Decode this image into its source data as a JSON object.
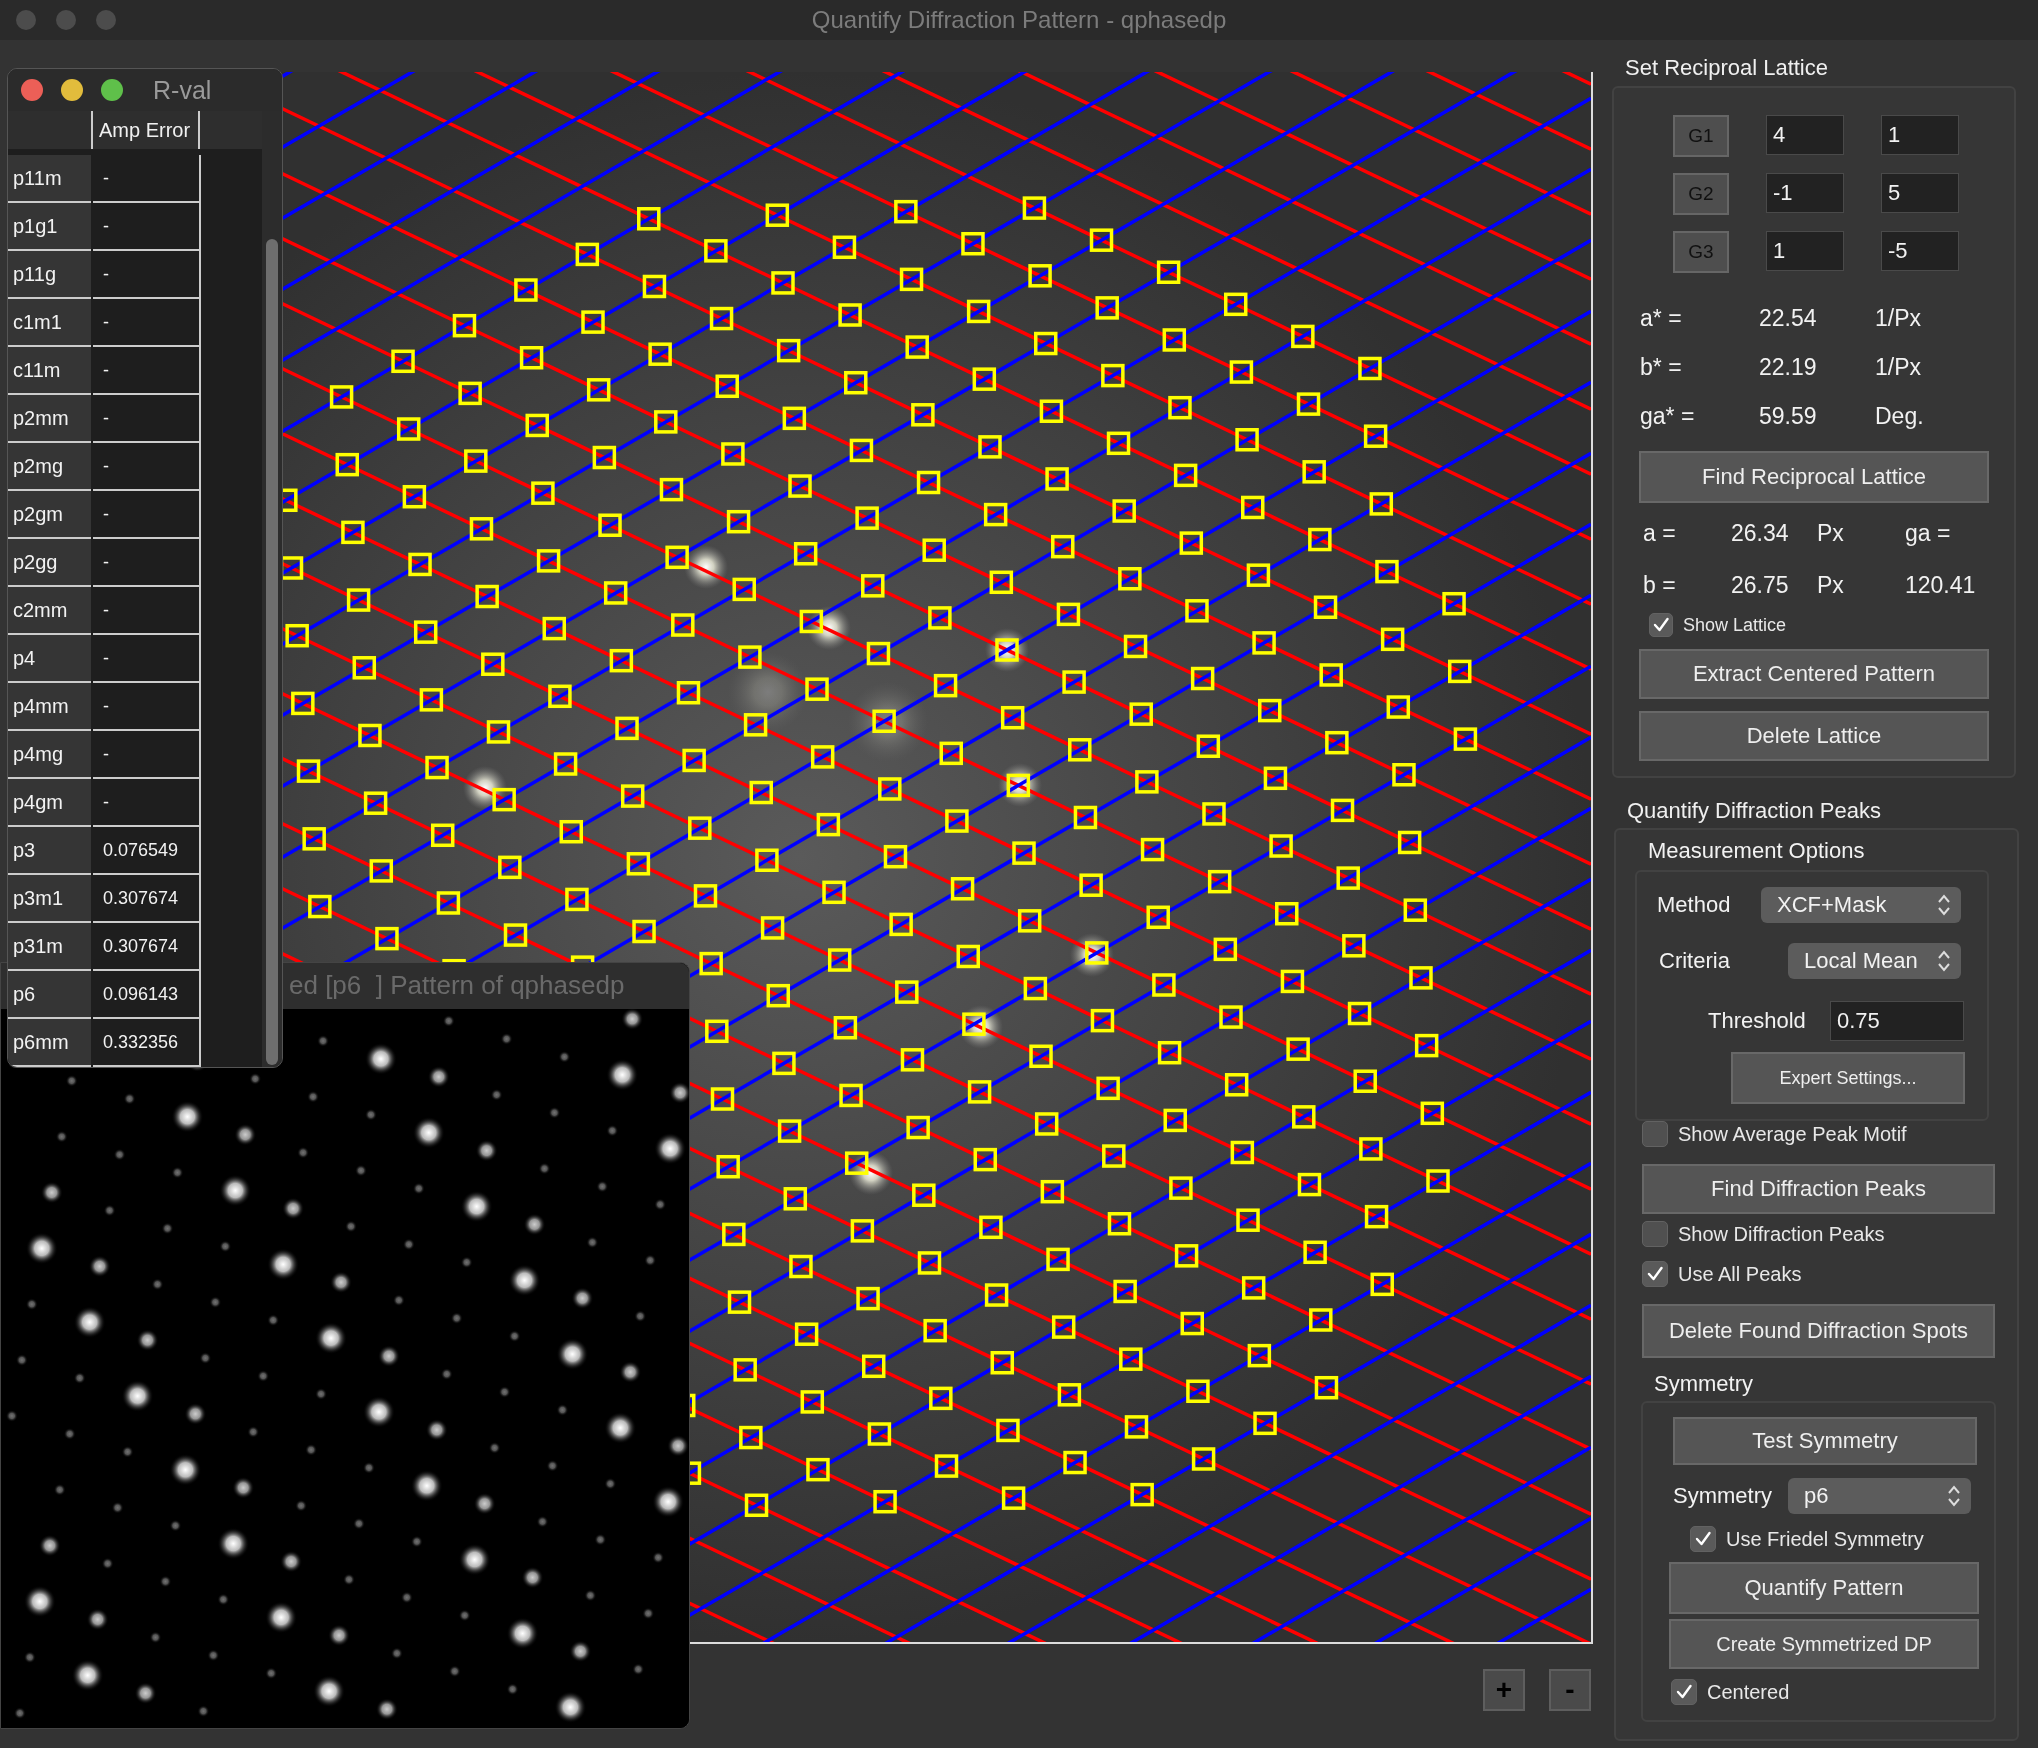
{
  "window": {
    "title": "Quantify Diffraction Pattern - qphasedp"
  },
  "image_view": {
    "zoom_buttons": [
      "+",
      "-"
    ]
  },
  "rval_window": {
    "title": "R-val",
    "columns": [
      "Amp Error"
    ],
    "rows": [
      {
        "group": "p11m",
        "amp_error": "-"
      },
      {
        "group": "p1g1",
        "amp_error": "-"
      },
      {
        "group": "p11g",
        "amp_error": "-"
      },
      {
        "group": "c1m1",
        "amp_error": "-"
      },
      {
        "group": "c11m",
        "amp_error": "-"
      },
      {
        "group": "p2mm",
        "amp_error": "-"
      },
      {
        "group": "p2mg",
        "amp_error": "-"
      },
      {
        "group": "p2gm",
        "amp_error": "-"
      },
      {
        "group": "p2gg",
        "amp_error": "-"
      },
      {
        "group": "c2mm",
        "amp_error": "-"
      },
      {
        "group": "p4",
        "amp_error": "-"
      },
      {
        "group": "p4mm",
        "amp_error": "-"
      },
      {
        "group": "p4mg",
        "amp_error": "-"
      },
      {
        "group": "p4gm",
        "amp_error": "-"
      },
      {
        "group": "p3",
        "amp_error": "0.076549"
      },
      {
        "group": "p3m1",
        "amp_error": "0.307674"
      },
      {
        "group": "p31m",
        "amp_error": "0.307674"
      },
      {
        "group": "p6",
        "amp_error": "0.096143"
      },
      {
        "group": "p6mm",
        "amp_error": "0.332356"
      }
    ]
  },
  "pattern_window": {
    "title": "ed [p6  ] Pattern of qphasedp"
  },
  "set_reciprocal_lattice": {
    "title": "Set Reciproal Lattice",
    "vectors": [
      {
        "label": "G1",
        "h": "4",
        "k": "1"
      },
      {
        "label": "G2",
        "h": "-1",
        "k": "5"
      },
      {
        "label": "G3",
        "h": "1",
        "k": "-5"
      }
    ],
    "reciprocal_params": [
      {
        "label": "a* =",
        "value": "22.54",
        "unit": "1/Px"
      },
      {
        "label": "b* =",
        "value": "22.19",
        "unit": "1/Px"
      },
      {
        "label": "ga* =",
        "value": "59.59",
        "unit": "Deg."
      }
    ],
    "find_button": "Find Reciprocal Lattice",
    "real_params": [
      {
        "label": "a =",
        "value": "26.34",
        "unit": "Px",
        "extra": "ga ="
      },
      {
        "label": "b =",
        "value": "26.75",
        "unit": "Px",
        "extra": "120.41"
      }
    ],
    "show_lattice": {
      "label": "Show Lattice",
      "checked": true
    },
    "buttons": [
      "Extract Centered Pattern",
      "Delete Lattice"
    ]
  },
  "quantify_diffraction_peaks": {
    "title": "Quantify Diffraction Peaks",
    "measurement_options": {
      "title": "Measurement Options",
      "method": {
        "label": "Method",
        "value": "XCF+Mask"
      },
      "criteria": {
        "label": "Criteria",
        "value": "Local Mean"
      },
      "threshold": {
        "label": "Threshold",
        "value": "0.75"
      },
      "expert_button": "Expert Settings..."
    },
    "controls": [
      {
        "kind": "checkbox",
        "label": "Show Average Peak Motif",
        "checked": false
      },
      {
        "kind": "button",
        "label": "Find Diffraction Peaks"
      },
      {
        "kind": "checkbox",
        "label": "Show Diffraction Peaks",
        "checked": false
      },
      {
        "kind": "checkbox",
        "label": "Use All Peaks",
        "checked": true
      },
      {
        "kind": "button",
        "label": "Delete Found Diffraction Spots"
      }
    ],
    "symmetry": {
      "title": "Symmetry",
      "test_button": "Test Symmetry",
      "select": {
        "label": "Symmetry",
        "value": "p6"
      },
      "friedel": {
        "label": "Use Friedel Symmetry",
        "checked": true
      },
      "quantify_button": "Quantify Pattern",
      "create_button": "Create Symmetrized DP",
      "centered": {
        "label": "Centered",
        "checked": true
      }
    }
  }
}
